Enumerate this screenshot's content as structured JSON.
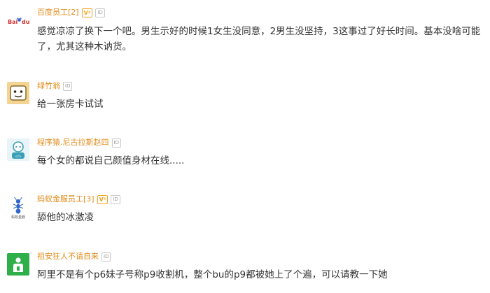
{
  "badges": {
    "v": "V²",
    "id": "ID"
  },
  "comments": [
    {
      "author": "百度员工[2]",
      "avatar": "baidu-logo-icon",
      "avatar_text": "Baiடdu",
      "has_v": true,
      "text": "感觉凉凉了换下一个吧。男生示好的时候1女生没同意，2男生没坚持，3这事过了好长时间。基本没啥可能了，尤其这种木讷货。"
    },
    {
      "author": "绿竹翁",
      "avatar": "face-cartoon-icon",
      "has_v": false,
      "text": "给一张房卡试试"
    },
    {
      "author": "程序猿.尼古拉斯赵四",
      "avatar": "programmer-avatar-icon",
      "has_v": false,
      "text": "每个女的都说自己颜值身材在线....."
    },
    {
      "author": "蚂蚁金服员工[3]",
      "avatar": "ant-financial-logo-icon",
      "avatar_text": "蚂蚁金服",
      "has_v": true,
      "text": "舔他的冰激凌"
    },
    {
      "author": "祖安狂人不请自来",
      "avatar": "green-person-icon",
      "has_v": false,
      "text": "阿里不是有个p6妹子号称p9收割机，整个bu的p9都被她上了个遍，可以请教一下她"
    }
  ],
  "colors": {
    "author": "#e28b1a",
    "text": "#333333",
    "badge_v": "#f2a323",
    "badge_id": "#9a9a9a"
  }
}
